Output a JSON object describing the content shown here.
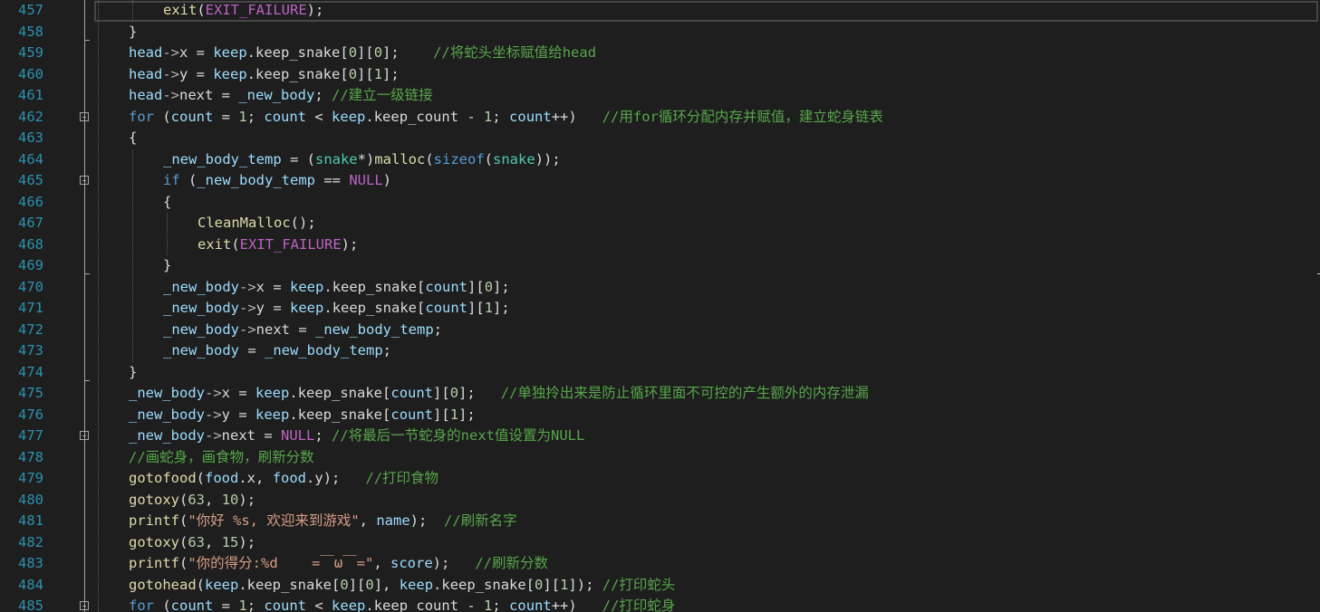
{
  "editor": {
    "lines": [
      {
        "num": "457",
        "indent": 2,
        "tokens": [
          [
            "fn",
            "exit"
          ],
          [
            "pl",
            "("
          ],
          [
            "mac",
            "EXIT_FAILURE"
          ],
          [
            "pl",
            ");"
          ]
        ],
        "current": true
      },
      {
        "num": "458",
        "indent": 1,
        "tokens": [
          [
            "pl",
            "}"
          ]
        ]
      },
      {
        "num": "459",
        "indent": 1,
        "tokens": [
          [
            "var",
            "head"
          ],
          [
            "op",
            "->"
          ],
          [
            "mem",
            "x"
          ],
          [
            "pl",
            " = "
          ],
          [
            "var",
            "keep"
          ],
          [
            "pl",
            "."
          ],
          [
            "mem",
            "keep_snake"
          ],
          [
            "pl",
            "["
          ],
          [
            "num",
            "0"
          ],
          [
            "pl",
            "]["
          ],
          [
            "num",
            "0"
          ],
          [
            "pl",
            "];    "
          ],
          [
            "cm",
            "//将蛇头坐标赋值给head"
          ]
        ]
      },
      {
        "num": "460",
        "indent": 1,
        "tokens": [
          [
            "var",
            "head"
          ],
          [
            "op",
            "->"
          ],
          [
            "mem",
            "y"
          ],
          [
            "pl",
            " = "
          ],
          [
            "var",
            "keep"
          ],
          [
            "pl",
            "."
          ],
          [
            "mem",
            "keep_snake"
          ],
          [
            "pl",
            "["
          ],
          [
            "num",
            "0"
          ],
          [
            "pl",
            "]["
          ],
          [
            "num",
            "1"
          ],
          [
            "pl",
            "];"
          ]
        ]
      },
      {
        "num": "461",
        "indent": 1,
        "tokens": [
          [
            "var",
            "head"
          ],
          [
            "op",
            "->"
          ],
          [
            "mem",
            "next"
          ],
          [
            "pl",
            " = "
          ],
          [
            "var",
            "_new_body"
          ],
          [
            "pl",
            "; "
          ],
          [
            "cm",
            "//建立一级链接"
          ]
        ]
      },
      {
        "num": "462",
        "indent": 1,
        "fold": true,
        "tokens": [
          [
            "kw",
            "for"
          ],
          [
            "pl",
            " ("
          ],
          [
            "var",
            "count"
          ],
          [
            "pl",
            " = "
          ],
          [
            "num",
            "1"
          ],
          [
            "pl",
            "; "
          ],
          [
            "var",
            "count"
          ],
          [
            "pl",
            " < "
          ],
          [
            "var",
            "keep"
          ],
          [
            "pl",
            "."
          ],
          [
            "mem",
            "keep_count"
          ],
          [
            "pl",
            " - "
          ],
          [
            "num",
            "1"
          ],
          [
            "pl",
            "; "
          ],
          [
            "var",
            "count"
          ],
          [
            "pl",
            "++)   "
          ],
          [
            "cm",
            "//用for循环分配内存并赋值，建立蛇身链表"
          ]
        ]
      },
      {
        "num": "463",
        "indent": 1,
        "tokens": [
          [
            "pl",
            "{"
          ]
        ]
      },
      {
        "num": "464",
        "indent": 2,
        "tokens": [
          [
            "var",
            "_new_body_temp"
          ],
          [
            "pl",
            " = ("
          ],
          [
            "ty",
            "snake"
          ],
          [
            "pl",
            "*)"
          ],
          [
            "fn",
            "malloc"
          ],
          [
            "pl",
            "("
          ],
          [
            "kw",
            "sizeof"
          ],
          [
            "pl",
            "("
          ],
          [
            "ty",
            "snake"
          ],
          [
            "pl",
            "));"
          ]
        ]
      },
      {
        "num": "465",
        "indent": 2,
        "fold": true,
        "tokens": [
          [
            "kw",
            "if"
          ],
          [
            "pl",
            " ("
          ],
          [
            "var",
            "_new_body_temp"
          ],
          [
            "pl",
            " == "
          ],
          [
            "mac",
            "NULL"
          ],
          [
            "pl",
            ")"
          ]
        ]
      },
      {
        "num": "466",
        "indent": 2,
        "tokens": [
          [
            "pl",
            "{"
          ]
        ]
      },
      {
        "num": "467",
        "indent": 3,
        "tokens": [
          [
            "fn",
            "CleanMalloc"
          ],
          [
            "pl",
            "();"
          ]
        ]
      },
      {
        "num": "468",
        "indent": 3,
        "tokens": [
          [
            "fn",
            "exit"
          ],
          [
            "pl",
            "("
          ],
          [
            "mac",
            "EXIT_FAILURE"
          ],
          [
            "pl",
            ");"
          ]
        ]
      },
      {
        "num": "469",
        "indent": 2,
        "tokens": [
          [
            "pl",
            "}"
          ]
        ]
      },
      {
        "num": "470",
        "indent": 2,
        "tokens": [
          [
            "var",
            "_new_body"
          ],
          [
            "op",
            "->"
          ],
          [
            "mem",
            "x"
          ],
          [
            "pl",
            " = "
          ],
          [
            "var",
            "keep"
          ],
          [
            "pl",
            "."
          ],
          [
            "mem",
            "keep_snake"
          ],
          [
            "pl",
            "["
          ],
          [
            "var",
            "count"
          ],
          [
            "pl",
            "]["
          ],
          [
            "num",
            "0"
          ],
          [
            "pl",
            "];"
          ]
        ]
      },
      {
        "num": "471",
        "indent": 2,
        "tokens": [
          [
            "var",
            "_new_body"
          ],
          [
            "op",
            "->"
          ],
          [
            "mem",
            "y"
          ],
          [
            "pl",
            " = "
          ],
          [
            "var",
            "keep"
          ],
          [
            "pl",
            "."
          ],
          [
            "mem",
            "keep_snake"
          ],
          [
            "pl",
            "["
          ],
          [
            "var",
            "count"
          ],
          [
            "pl",
            "]["
          ],
          [
            "num",
            "1"
          ],
          [
            "pl",
            "];"
          ]
        ]
      },
      {
        "num": "472",
        "indent": 2,
        "tokens": [
          [
            "var",
            "_new_body"
          ],
          [
            "op",
            "->"
          ],
          [
            "mem",
            "next"
          ],
          [
            "pl",
            " = "
          ],
          [
            "var",
            "_new_body_temp"
          ],
          [
            "pl",
            ";"
          ]
        ]
      },
      {
        "num": "473",
        "indent": 2,
        "tokens": [
          [
            "var",
            "_new_body"
          ],
          [
            "pl",
            " = "
          ],
          [
            "var",
            "_new_body_temp"
          ],
          [
            "pl",
            ";"
          ]
        ]
      },
      {
        "num": "474",
        "indent": 1,
        "tokens": [
          [
            "pl",
            "}"
          ]
        ]
      },
      {
        "num": "475",
        "indent": 1,
        "tokens": [
          [
            "var",
            "_new_body"
          ],
          [
            "op",
            "->"
          ],
          [
            "mem",
            "x"
          ],
          [
            "pl",
            " = "
          ],
          [
            "var",
            "keep"
          ],
          [
            "pl",
            "."
          ],
          [
            "mem",
            "keep_snake"
          ],
          [
            "pl",
            "["
          ],
          [
            "var",
            "count"
          ],
          [
            "pl",
            "]["
          ],
          [
            "num",
            "0"
          ],
          [
            "pl",
            "];   "
          ],
          [
            "cm",
            "//单独拎出来是防止循环里面不可控的产生额外的内存泄漏"
          ]
        ]
      },
      {
        "num": "476",
        "indent": 1,
        "tokens": [
          [
            "var",
            "_new_body"
          ],
          [
            "op",
            "->"
          ],
          [
            "mem",
            "y"
          ],
          [
            "pl",
            " = "
          ],
          [
            "var",
            "keep"
          ],
          [
            "pl",
            "."
          ],
          [
            "mem",
            "keep_snake"
          ],
          [
            "pl",
            "["
          ],
          [
            "var",
            "count"
          ],
          [
            "pl",
            "]["
          ],
          [
            "num",
            "1"
          ],
          [
            "pl",
            "];"
          ]
        ]
      },
      {
        "num": "477",
        "indent": 1,
        "fold": true,
        "tokens": [
          [
            "var",
            "_new_body"
          ],
          [
            "op",
            "->"
          ],
          [
            "mem",
            "next"
          ],
          [
            "pl",
            " = "
          ],
          [
            "mac",
            "NULL"
          ],
          [
            "pl",
            "; "
          ],
          [
            "cm",
            "//将最后一节蛇身的next值设置为NULL"
          ]
        ]
      },
      {
        "num": "478",
        "indent": 1,
        "tokens": [
          [
            "cm",
            "//画蛇身，画食物，刷新分数"
          ]
        ]
      },
      {
        "num": "479",
        "indent": 1,
        "tokens": [
          [
            "fn",
            "gotofood"
          ],
          [
            "pl",
            "("
          ],
          [
            "var",
            "food"
          ],
          [
            "pl",
            "."
          ],
          [
            "mem",
            "x"
          ],
          [
            "pl",
            ", "
          ],
          [
            "var",
            "food"
          ],
          [
            "pl",
            "."
          ],
          [
            "mem",
            "y"
          ],
          [
            "pl",
            ");   "
          ],
          [
            "cm",
            "//打印食物"
          ]
        ]
      },
      {
        "num": "480",
        "indent": 1,
        "tokens": [
          [
            "fn",
            "gotoxy"
          ],
          [
            "pl",
            "("
          ],
          [
            "num",
            "63"
          ],
          [
            "pl",
            ", "
          ],
          [
            "num",
            "10"
          ],
          [
            "pl",
            ");"
          ]
        ]
      },
      {
        "num": "481",
        "indent": 1,
        "tokens": [
          [
            "fn",
            "printf"
          ],
          [
            "pl",
            "("
          ],
          [
            "str",
            "\"你好 %s, 欢迎来到游戏\""
          ],
          [
            "pl",
            ", "
          ],
          [
            "var",
            "name"
          ],
          [
            "pl",
            ");  "
          ],
          [
            "cm",
            "//刷新名字"
          ]
        ]
      },
      {
        "num": "482",
        "indent": 1,
        "tokens": [
          [
            "fn",
            "gotoxy"
          ],
          [
            "pl",
            "("
          ],
          [
            "num",
            "63"
          ],
          [
            "pl",
            ", "
          ],
          [
            "num",
            "15"
          ],
          [
            "pl",
            ");"
          ]
        ]
      },
      {
        "num": "483",
        "indent": 1,
        "tokens": [
          [
            "fn",
            "printf"
          ],
          [
            "pl",
            "("
          ],
          [
            "str",
            "\"你的得分:%d    =￣ω￣=\""
          ],
          [
            "pl",
            ", "
          ],
          [
            "var",
            "score"
          ],
          [
            "pl",
            ");   "
          ],
          [
            "cm",
            "//刷新分数"
          ]
        ]
      },
      {
        "num": "484",
        "indent": 1,
        "tokens": [
          [
            "fn",
            "gotohead"
          ],
          [
            "pl",
            "("
          ],
          [
            "var",
            "keep"
          ],
          [
            "pl",
            "."
          ],
          [
            "mem",
            "keep_snake"
          ],
          [
            "pl",
            "["
          ],
          [
            "num",
            "0"
          ],
          [
            "pl",
            "]["
          ],
          [
            "num",
            "0"
          ],
          [
            "pl",
            "], "
          ],
          [
            "var",
            "keep"
          ],
          [
            "pl",
            "."
          ],
          [
            "mem",
            "keep_snake"
          ],
          [
            "pl",
            "["
          ],
          [
            "num",
            "0"
          ],
          [
            "pl",
            "]["
          ],
          [
            "num",
            "1"
          ],
          [
            "pl",
            "]); "
          ],
          [
            "cm",
            "//打印蛇头"
          ]
        ]
      },
      {
        "num": "485",
        "indent": 1,
        "fold": true,
        "tokens": [
          [
            "kw",
            "for"
          ],
          [
            "pl",
            " ("
          ],
          [
            "var",
            "count"
          ],
          [
            "pl",
            " = "
          ],
          [
            "num",
            "1"
          ],
          [
            "pl",
            "; "
          ],
          [
            "var",
            "count"
          ],
          [
            "pl",
            " < "
          ],
          [
            "var",
            "keep"
          ],
          [
            "pl",
            "."
          ],
          [
            "mem",
            "keep_count"
          ],
          [
            "pl",
            " - "
          ],
          [
            "num",
            "1"
          ],
          [
            "pl",
            "; "
          ],
          [
            "var",
            "count"
          ],
          [
            "pl",
            "++)   "
          ],
          [
            "cm",
            "//打印蛇身"
          ]
        ]
      }
    ]
  }
}
